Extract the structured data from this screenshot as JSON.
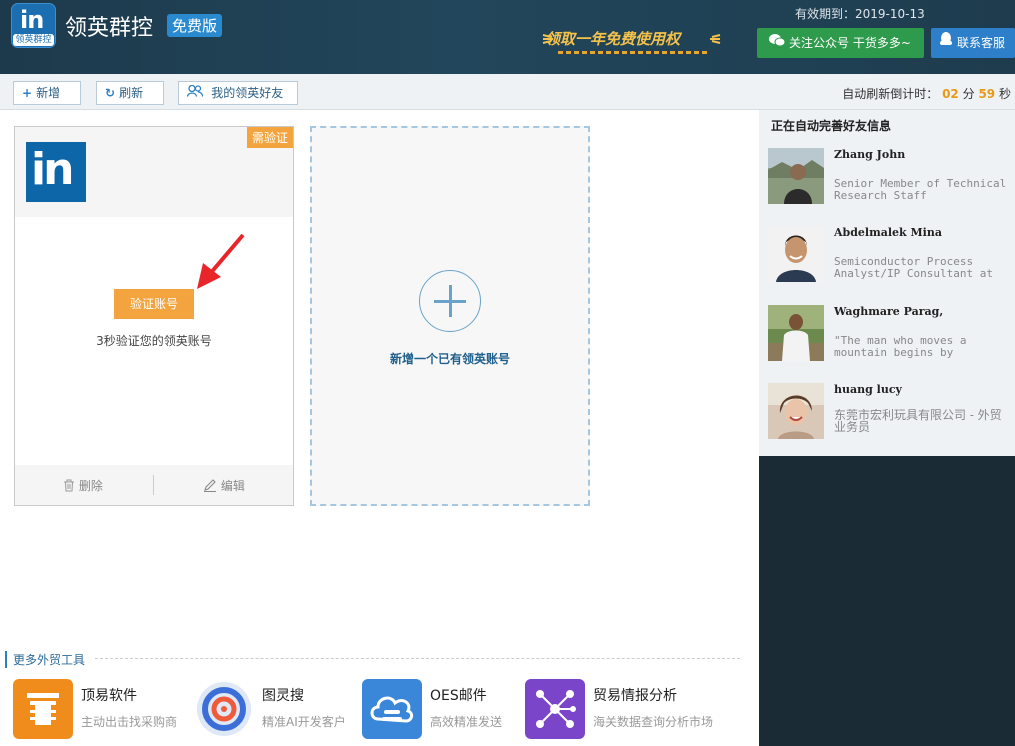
{
  "header": {
    "app_title": "领英群控",
    "edition_badge": "免费版",
    "logo_text": "in",
    "logo_caption": "领英群控",
    "promo_text": "领取一年免费使用权",
    "expiry": "有效期到：2019-10-13",
    "wechat_button": "关注公众号 干货多多~",
    "service_button": "联系客服"
  },
  "toolbar": {
    "add_label": "新增",
    "refresh_label": "刷新",
    "friends_label": "我的领英好友",
    "countdown_prefix": "自动刷新倒计时：",
    "countdown_min": "02",
    "countdown_min_unit": "分",
    "countdown_sec": "59",
    "countdown_sec_unit": "秒"
  },
  "account_card": {
    "status_badge": "需验证",
    "verify_button": "验证账号",
    "verify_tip": "3秒验证您的领英账号",
    "delete_label": "删除",
    "edit_label": "编辑"
  },
  "add_card": {
    "label": "新增一个已有领英账号"
  },
  "more_tools": {
    "title": "更多外贸工具",
    "items": [
      {
        "name": "顶易软件",
        "desc": "主动出击找采购商",
        "color": "#f08c1c",
        "icon": "pillar-icon"
      },
      {
        "name": "图灵搜",
        "desc": "精准AI开发客户",
        "color": "#ffffff",
        "icon": "target-icon"
      },
      {
        "name": "OES邮件",
        "desc": "高效精准发送",
        "color": "#3a86d8",
        "icon": "cloud-mail-icon"
      },
      {
        "name": "贸易情报分析",
        "desc": "海关数据查询分析市场",
        "color": "#7a45c8",
        "icon": "network-icon"
      }
    ]
  },
  "right_panel": {
    "title": "正在自动完善好友信息",
    "friends": [
      {
        "name": "Zhang John",
        "desc": "Senior Member of Technical Research Staff"
      },
      {
        "name": "Abdelmalek Mina",
        "desc": "Semiconductor Process Analyst/IP Consultant at"
      },
      {
        "name": "Waghmare Parag,",
        "desc": "\"The man who moves a mountain begins by"
      },
      {
        "name": "huang lucy",
        "desc": "东莞市宏利玩具有限公司 - 外贸业务员"
      }
    ]
  }
}
